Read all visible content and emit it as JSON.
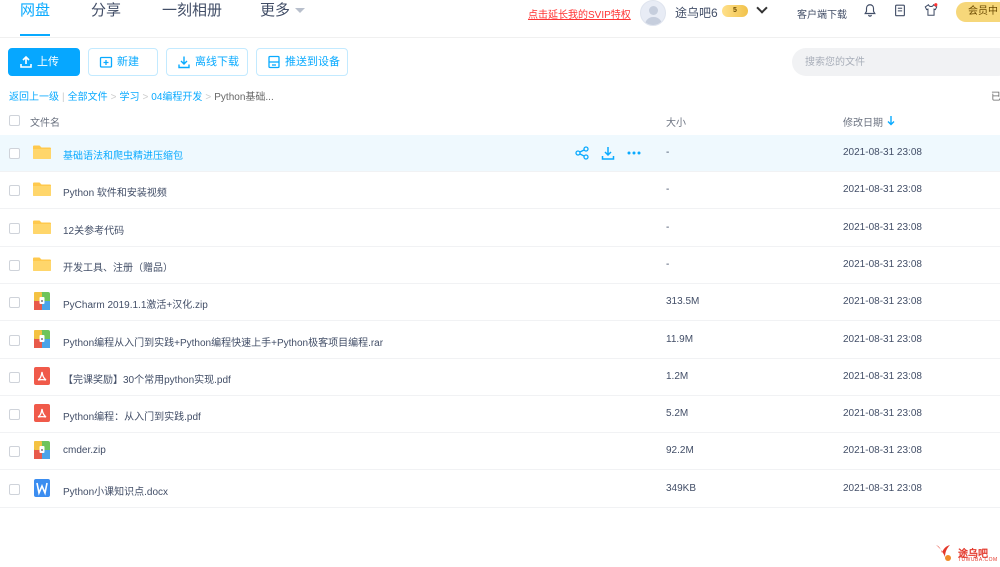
{
  "nav": {
    "tabs": [
      {
        "label": "网盘"
      },
      {
        "label": "分享"
      },
      {
        "label": "一刻相册"
      },
      {
        "label": "更多"
      }
    ],
    "svip_link": "点击延长我的SVIP特权",
    "username": "途乌吧6",
    "vip_level": "5",
    "client_download": "客户端下载",
    "member_center": "会员中"
  },
  "toolbar": {
    "upload": "上传",
    "new": "新建",
    "offline_download": "离线下载",
    "push_to_device": "推送到设备",
    "search_placeholder": "搜索您的文件"
  },
  "breadcrumb": {
    "back": "返回上一级",
    "items": [
      "全部文件",
      "学习",
      "04编程开发",
      "Python基础..."
    ],
    "right_text": "已"
  },
  "table": {
    "headers": {
      "name": "文件名",
      "size": "大小",
      "modified": "修改日期"
    },
    "rows": [
      {
        "name": "基础语法和爬虫精进压缩包",
        "type": "folder",
        "size": "-",
        "date": "2021-08-31 23:08",
        "highlighted": true
      },
      {
        "name": "Python 软件和安装视频",
        "type": "folder",
        "size": "-",
        "date": "2021-08-31 23:08"
      },
      {
        "name": "12关参考代码",
        "type": "folder",
        "size": "-",
        "date": "2021-08-31 23:08"
      },
      {
        "name": "开发工具、注册（赠品）",
        "type": "folder",
        "size": "-",
        "date": "2021-08-31 23:08"
      },
      {
        "name": "PyCharm 2019.1.1激活+汉化.zip",
        "type": "zip",
        "size": "313.5M",
        "date": "2021-08-31 23:08"
      },
      {
        "name": "Python编程从入门到实践+Python编程快速上手+Python极客项目编程.rar",
        "type": "zip",
        "size": "11.9M",
        "date": "2021-08-31 23:08"
      },
      {
        "name": "【完课奖励】30个常用python实现.pdf",
        "type": "pdf",
        "size": "1.2M",
        "date": "2021-08-31 23:08"
      },
      {
        "name": "Python编程：从入门到实践.pdf",
        "type": "pdf",
        "size": "5.2M",
        "date": "2021-08-31 23:08"
      },
      {
        "name": "cmder.zip",
        "type": "zip",
        "size": "92.2M",
        "date": "2021-08-31 23:08"
      },
      {
        "name": "Python小课知识点.docx",
        "type": "docx",
        "size": "349KB",
        "date": "2021-08-31 23:08"
      }
    ]
  },
  "watermark": {
    "text": "途乌吧",
    "sub": "TUWUBA.COM"
  },
  "colors": {
    "accent": "#06a7ff",
    "folder": "#ffc94d",
    "pdf": "#f05a4a",
    "docx": "#3b8df0"
  }
}
